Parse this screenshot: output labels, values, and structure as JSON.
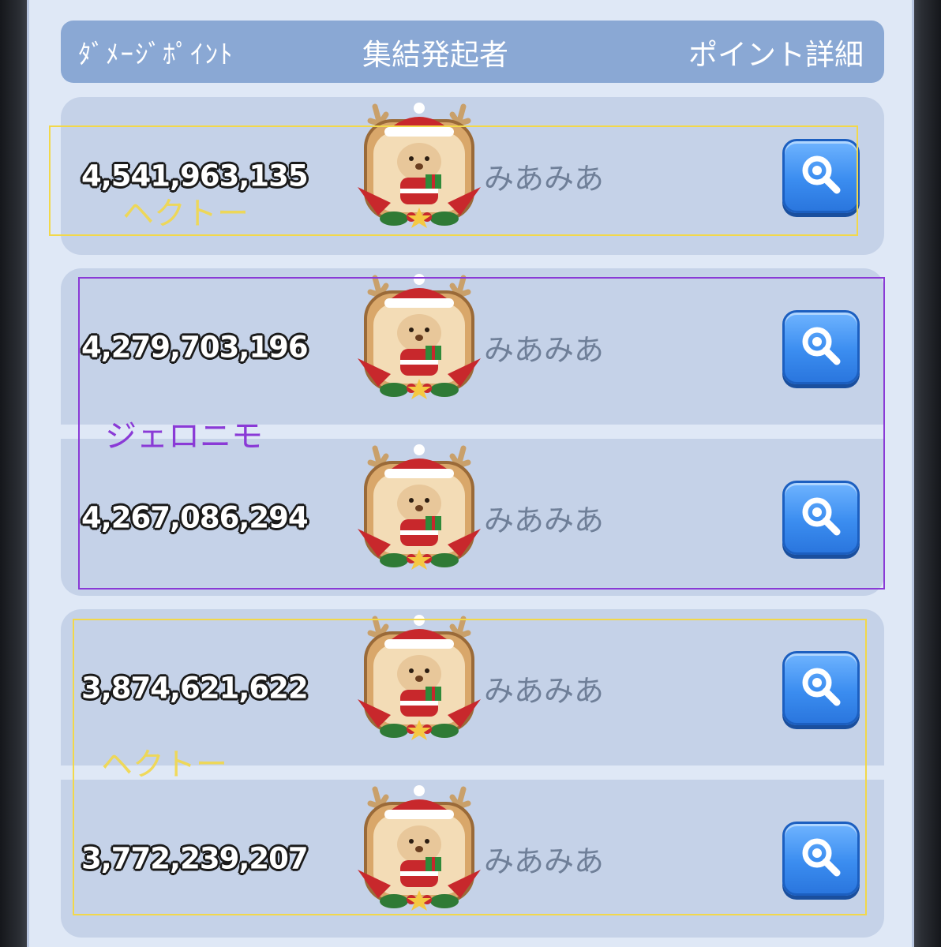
{
  "header": {
    "damage_points": "ﾀﾞﾒｰｼﾞﾎﾟｲﾝﾄ",
    "rally_initiator": "集結発起者",
    "point_details": "ポイント詳細"
  },
  "rows": [
    {
      "points": "4,541,963,135",
      "name": "みあみあ"
    },
    {
      "points": "4,279,703,196",
      "name": "みあみあ"
    },
    {
      "points": "4,267,086,294",
      "name": "みあみあ"
    },
    {
      "points": "3,874,621,622",
      "name": "みあみあ"
    },
    {
      "points": "3,772,239,207",
      "name": "みあみあ"
    }
  ],
  "annotations": [
    {
      "label": "ヘクトー",
      "color": "#f2d84a"
    },
    {
      "label": "ジェロニモ",
      "color": "#8a3ad6"
    },
    {
      "label": "ヘクトー",
      "color": "#f2d84a"
    }
  ],
  "icons": {
    "avatar": "reindeer-santa-avatar-icon",
    "detail": "magnifier-icon"
  },
  "colors": {
    "panel_bg": "#dfe8f6",
    "header_bg": "#8aa8d4",
    "row_bg": "#c5d2e8",
    "button_blue": "#3b8df0"
  }
}
